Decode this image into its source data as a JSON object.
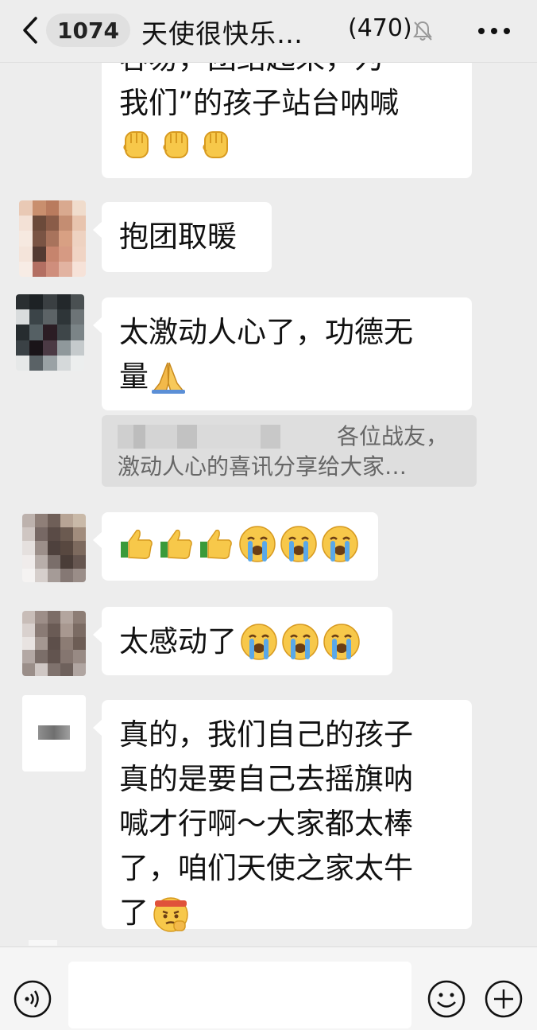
{
  "header": {
    "unread_count": "1074",
    "title": "天使很快乐…",
    "member_count": "(470)"
  },
  "messages": [
    {
      "lines": [
        "容易，团结起来，为",
        "我们”的孩子站台呐喊"
      ],
      "emoji": [
        "fist-emoji",
        "fist-emoji",
        "fist-emoji"
      ]
    },
    {
      "text": "抱团取暖"
    },
    {
      "lines": [
        "太激动人心了，功德无",
        "量"
      ],
      "emoji": [
        "pray-emoji"
      ]
    },
    {
      "quote_line1": "各位战友，",
      "quote_line2": "激动人心的喜讯分享给大家…"
    },
    {
      "emoji": [
        "thumbs-up-emoji",
        "thumbs-up-emoji",
        "thumbs-up-emoji",
        "crying-emoji",
        "crying-emoji",
        "crying-emoji"
      ]
    },
    {
      "text": "太感动了",
      "emoji": [
        "crying-emoji",
        "crying-emoji",
        "crying-emoji"
      ]
    },
    {
      "lines": [
        "真的，我们自己的孩子",
        "真的是要自己去摇旗呐",
        "喊才行啊～大家都太棒",
        "了，咱们天使之家太牛",
        "了"
      ],
      "emoji": [
        "determined-face-emoji"
      ]
    }
  ],
  "colors": {
    "background": "#ededed",
    "bubble": "#ffffff",
    "quote": "#dedede"
  }
}
